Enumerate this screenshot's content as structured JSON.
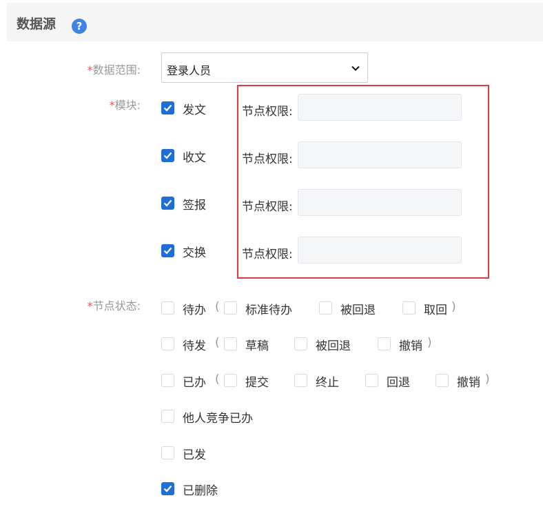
{
  "header": {
    "title": "数据源",
    "help_icon": "question-circle-icon"
  },
  "data_range": {
    "label": "数据范围:",
    "required_mark": "*",
    "value": "登录人员"
  },
  "modules": {
    "label": "模块:",
    "required_mark": "*",
    "node_permission_label": "节点权限:",
    "items": [
      {
        "label": "发文",
        "checked": true,
        "node_permission": ""
      },
      {
        "label": "收文",
        "checked": true,
        "node_permission": ""
      },
      {
        "label": "签报",
        "checked": true,
        "node_permission": ""
      },
      {
        "label": "交换",
        "checked": true,
        "node_permission": ""
      }
    ]
  },
  "node_status": {
    "label": "节点状态:",
    "required_mark": "*",
    "open_paren": "(",
    "close_paren": ")",
    "pending": {
      "label": "待办",
      "checked": false,
      "subs": [
        {
          "label": "标准待办",
          "checked": false
        },
        {
          "label": "被回退",
          "checked": false
        },
        {
          "label": "取回",
          "checked": false
        }
      ]
    },
    "to_send": {
      "label": "待发",
      "checked": false,
      "subs": [
        {
          "label": "草稿",
          "checked": false
        },
        {
          "label": "被回退",
          "checked": false
        },
        {
          "label": "撤销",
          "checked": false
        }
      ]
    },
    "done": {
      "label": "已办",
      "checked": false,
      "subs": [
        {
          "label": "提交",
          "checked": false
        },
        {
          "label": "终止",
          "checked": false
        },
        {
          "label": "回退",
          "checked": false
        },
        {
          "label": "撤销",
          "checked": false
        }
      ]
    },
    "others_done": {
      "label": "他人竞争已办",
      "checked": false
    },
    "sent": {
      "label": "已发",
      "checked": false
    },
    "deleted": {
      "label": "已删除",
      "checked": true
    }
  },
  "colors": {
    "accent": "#1f6ed6",
    "required": "#e85a5a",
    "highlight": "#e03a3a",
    "label": "#999999"
  }
}
